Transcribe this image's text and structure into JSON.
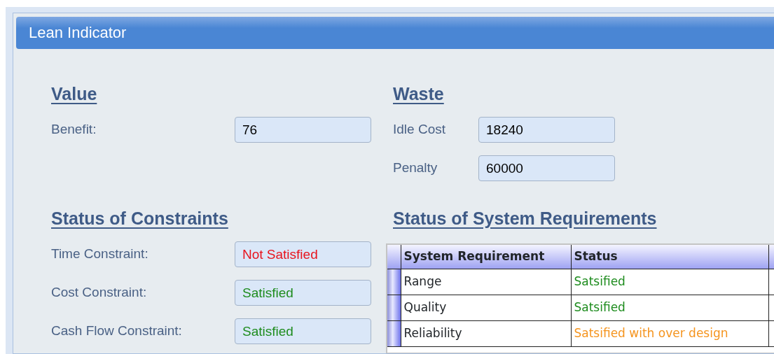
{
  "window": {
    "title": "Lean Indicator"
  },
  "value": {
    "heading": "Value",
    "fields": [
      {
        "label": "Benefit:",
        "value": "76"
      }
    ]
  },
  "waste": {
    "heading": "Waste",
    "fields": [
      {
        "label": "Idle Cost",
        "value": "18240"
      },
      {
        "label": "Penalty",
        "value": "60000"
      }
    ]
  },
  "constraints": {
    "heading": "Status of Constraints",
    "fields": [
      {
        "label": "Time Constraint:",
        "value": "Not Satisfied",
        "color": "#e8141e"
      },
      {
        "label": "Cost Constraint:",
        "value": "Satisfied",
        "color": "#1e8c1e"
      },
      {
        "label": "Cash Flow Constraint:",
        "value": "Satisfied",
        "color": "#1e8c1e"
      }
    ]
  },
  "requirements": {
    "heading": "Status of System Requirements",
    "table": {
      "columns": [
        "System Requirement",
        "Status"
      ],
      "rows": [
        {
          "requirement": "Range",
          "status": "Satsified",
          "color": "#1e8c1e"
        },
        {
          "requirement": "Quality",
          "status": "Satsified",
          "color": "#1e8c1e"
        },
        {
          "requirement": "Reliability",
          "status": "Satsified with over design",
          "color": "#f5941e"
        }
      ]
    }
  }
}
